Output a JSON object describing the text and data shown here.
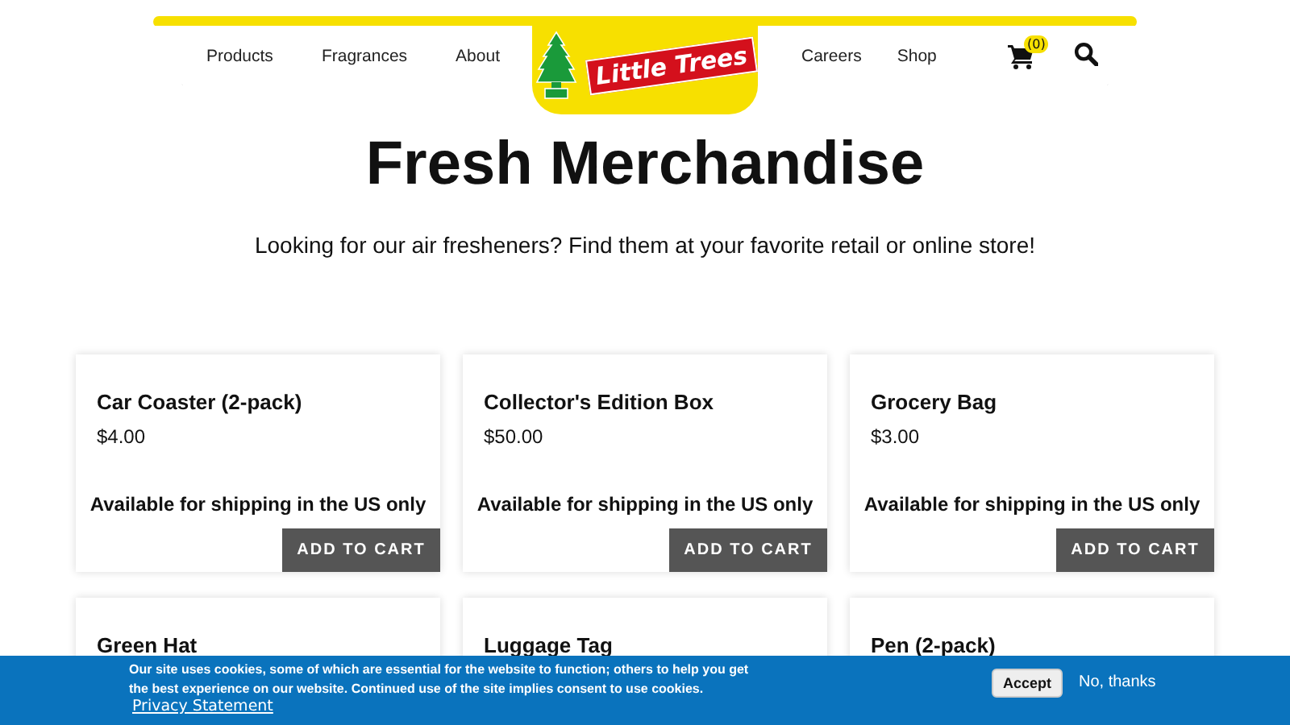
{
  "header": {
    "nav_left": [
      "Products",
      "Fragrances",
      "About"
    ],
    "logo_text": "Little Trees",
    "nav_right": [
      "Careers",
      "Shop"
    ],
    "cart_count": "(0)"
  },
  "page": {
    "title": "Fresh Merchandise",
    "subtitle": "Looking for our air fresheners? Find them at your favorite retail or online store!"
  },
  "products": [
    {
      "name": "Car Coaster (2-pack)",
      "price": "$4.00",
      "note": "Available for shipping in the US only",
      "button": "ADD TO CART"
    },
    {
      "name": "Collector's Edition Box",
      "price": "$50.00",
      "note": "Available for shipping in the US only",
      "button": "ADD TO CART"
    },
    {
      "name": "Grocery Bag",
      "price": "$3.00",
      "note": "Available for shipping in the US only",
      "button": "ADD TO CART"
    },
    {
      "name": "Green Hat"
    },
    {
      "name": "Luggage Tag"
    },
    {
      "name": "Pen (2-pack)"
    }
  ],
  "cookie_banner": {
    "message": "Our site uses cookies, some of which are essential for the website to function; others to help you get the best experience on our website. Continued use of the site implies consent to use cookies.",
    "link": "Privacy Statement",
    "accept": "Accept",
    "decline": "No, thanks"
  }
}
